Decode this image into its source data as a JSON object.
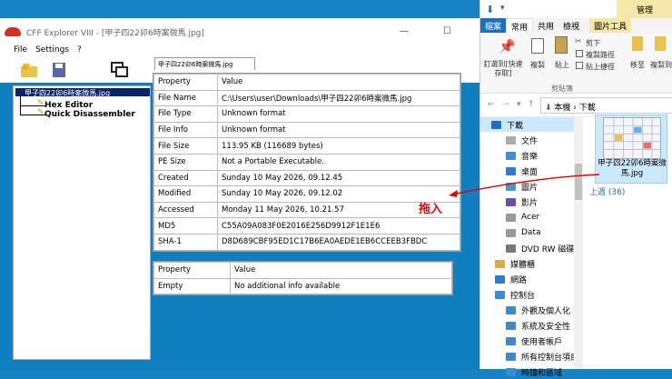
{
  "cff": {
    "title": "CFF Explorer VIII - [甲子四22卯6時案微馬.jpg]",
    "menu": [
      "File",
      "Settings",
      "?"
    ],
    "tab_label": "甲子四22卯6時案微馬.jpg",
    "tree": {
      "root": "甲子四22卯6時案微馬.jpg",
      "items": [
        "Hex Editor",
        "Quick Disassembler"
      ]
    },
    "props": {
      "headers": [
        "Property",
        "Value"
      ],
      "rows": [
        [
          "File Name",
          "C:\\Users\\user\\Downloads\\甲子四22卯6時案微馬.jpg"
        ],
        [
          "File Type",
          "Unknown format"
        ],
        [
          "File Info",
          "Unknown format"
        ],
        [
          "File Size",
          "113.95 KB (116689 bytes)"
        ],
        [
          "PE Size",
          "Not a Portable Executable."
        ],
        [
          "Created",
          "Sunday 10 May 2026, 09.12.45"
        ],
        [
          "Modified",
          "Sunday 10 May 2026, 09.12.02"
        ],
        [
          "Accessed",
          "Monday 11 May 2026, 10.21.57"
        ],
        [
          "MD5",
          "C55A09A083F0E2016E256D9912F1E1E6"
        ],
        [
          "SHA-1",
          "D8D689CBF95ED1C17B6EA0AEDE1EB6CCEEB3FBDC"
        ]
      ]
    },
    "extra": {
      "headers": [
        "Property",
        "Value"
      ],
      "rows": [
        [
          "Empty",
          "No additional info available"
        ]
      ]
    }
  },
  "annotation": "拖入",
  "explorer": {
    "manage_tab": "管理",
    "picture_tools": "圖片工具",
    "ribbon_tabs": [
      "檔案",
      "常用",
      "共用",
      "檢視",
      "圖片工具"
    ],
    "ribbon": {
      "pin": "釘選到[快速存取]",
      "copy": "複製",
      "paste": "貼上",
      "cut": "剪下",
      "copy_path": "複製路徑",
      "paste_shortcut": "貼上捷徑",
      "move_to": "移至",
      "copy_to": "複製到",
      "clipboard": "剪貼簿"
    },
    "address": "本機 › 下載",
    "nav": [
      "下載",
      "文件",
      "音樂",
      "桌面",
      "圖片",
      "影片",
      "Acer",
      "Data",
      "DVD RW 磁碟機",
      "媒體櫃",
      "網路",
      "控制台",
      "外觀及個人化",
      "系統及安全性",
      "使用者帳戶",
      "所有控制台項目",
      "時鐘和區域"
    ],
    "file_name": "甲子四22卯6時案微馬.jpg",
    "group": "上週 (36)"
  },
  "colors": {
    "accent": "#0f7fbf",
    "drag_arrow": "#e00000",
    "selection": "#cce8ff"
  }
}
